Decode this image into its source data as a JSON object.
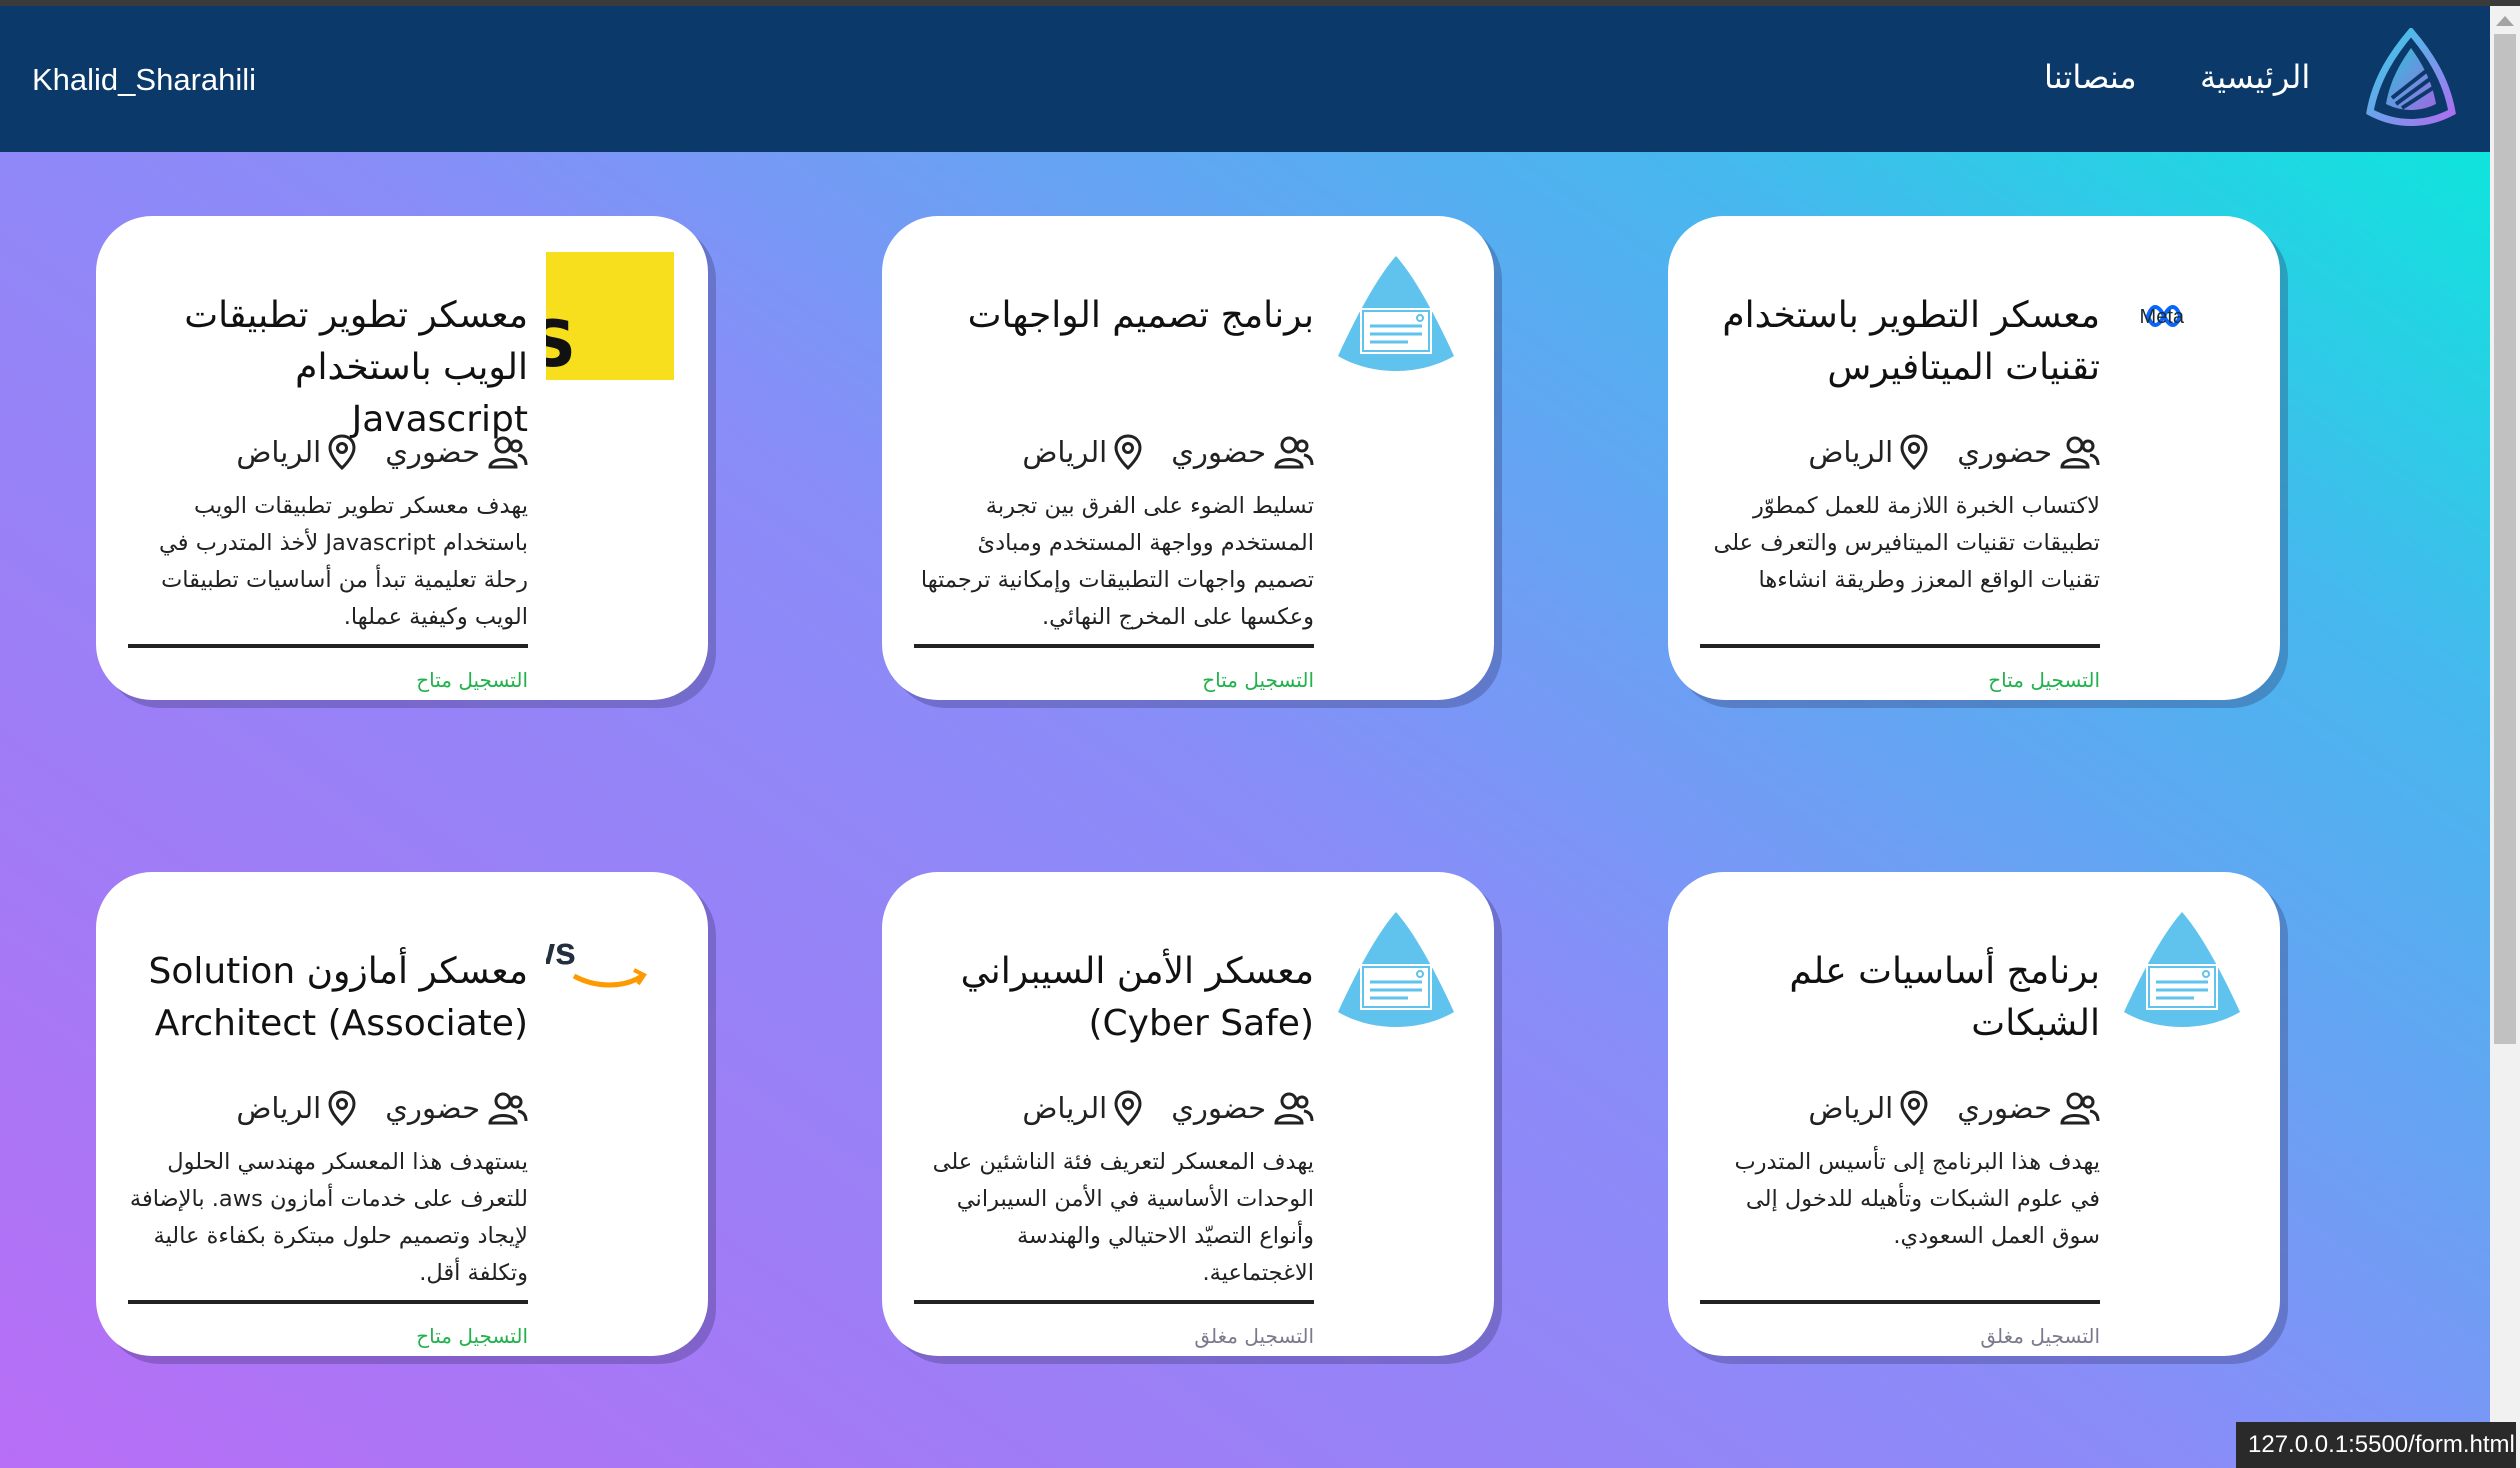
{
  "navbar": {
    "user": "Khalid_Sharahili",
    "home": "الرئيسية",
    "platforms": "منصاتنا",
    "logo_icon": "brand-tuwaiq-logo-icon",
    "background": "#0b3a6a"
  },
  "cards": [
    {
      "logo": "meta-logo-icon",
      "logo_text": "Meta",
      "title": "معسكر التطوير باستخدام تقنيات الميتافيرس",
      "mode": "حضوري",
      "city": "الرياض",
      "description": "لاكتساب الخبرة اللازمة للعمل كمطوّر تطبيقات تقنيات الميتافيرس والتعرف على تقنيات الواقع المعزز وطريقة انشاءها",
      "status": "التسجيل متاح"
    },
    {
      "logo": "certificate-icon",
      "title": "برنامج تصميم الواجهات",
      "mode": "حضوري",
      "city": "الرياض",
      "description": "تسليط الضوء على الفرق بين تجربة المستخدم وواجهة المستخدم ومبادئ تصميم واجهات التطبيقات وإمكانية ترجمتها وعكسها على المخرج النهائي.",
      "status": "التسجيل متاح"
    },
    {
      "logo": "javascript-logo-icon",
      "logo_text": "JS",
      "title": "معسكر تطوير تطبيقات الويب باستخدام Javascript",
      "mode": "حضوري",
      "city": "الرياض",
      "description": "يهدف معسكر تطوير تطبيقات الويب باستخدام Javascript لأخذ المتدرب في رحلة تعليمية تبدأ من أساسيات تطبيقات الويب وكيفية عملها.",
      "status": "التسجيل متاح"
    },
    {
      "logo": "certificate-icon",
      "title": "برنامج أساسيات علم الشبكات",
      "mode": "حضوري",
      "city": "الرياض",
      "description": "يهدف هذا البرنامج إلى تأسيس المتدرب في علوم الشبكات وتأهيله للدخول إلى سوق العمل السعودي.",
      "status": "التسجيل مغلق"
    },
    {
      "logo": "certificate-icon",
      "title": "معسكر الأمن السيبراني (Cyber Safe)",
      "mode": "حضوري",
      "city": "الرياض",
      "description": "يهدف المعسكر لتعريف فئة الناشئين على الوحدات الأساسية في الأمن السيبراني وأنواع التصيّد الاحتيالي والهندسة الاغجتماعية.",
      "status": "التسجيل مغلق"
    },
    {
      "logo": "aws-logo-icon",
      "logo_text": "aws",
      "title": "معسكر أمازون Solution Architect (Associate)",
      "mode": "حضوري",
      "city": "الرياض",
      "description": "يستهدف هذا المعسكر مهندسي الحلول للتعرف على خدمات أمازون aws. بالإضافة لإيجاد وتصميم حلول مبتكرة بكفاءة عالية وتكلفة أقل.",
      "status": "التسجيل متاح"
    }
  ],
  "status_bar": {
    "url": "127.0.0.1:5500/form.html"
  },
  "colors": {
    "status_open": "#22b24c",
    "status_closed": "#7a7a8c",
    "gradient_start": "#00f0d8",
    "gradient_end": "#b86ef6"
  }
}
